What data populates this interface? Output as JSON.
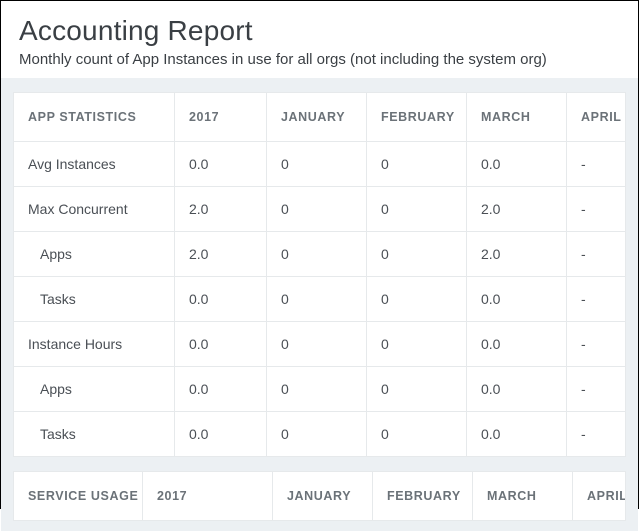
{
  "header": {
    "title": "Accounting Report",
    "subtitle": "Monthly count of App Instances in use for all orgs (not including the system org)"
  },
  "table1": {
    "columns": [
      "APP STATISTICS",
      "2017",
      "JANUARY",
      "FEBRUARY",
      "MARCH",
      "APRIL"
    ],
    "rows": [
      {
        "label": "Avg Instances",
        "indent": false,
        "values": [
          "0.0",
          "0",
          "0",
          "0.0",
          "-"
        ]
      },
      {
        "label": "Max Concurrent",
        "indent": false,
        "values": [
          "2.0",
          "0",
          "0",
          "2.0",
          "-"
        ]
      },
      {
        "label": "Apps",
        "indent": true,
        "values": [
          "2.0",
          "0",
          "0",
          "2.0",
          "-"
        ]
      },
      {
        "label": "Tasks",
        "indent": true,
        "values": [
          "0.0",
          "0",
          "0",
          "0.0",
          "-"
        ]
      },
      {
        "label": "Instance Hours",
        "indent": false,
        "values": [
          "0.0",
          "0",
          "0",
          "0.0",
          "-"
        ]
      },
      {
        "label": "Apps",
        "indent": true,
        "values": [
          "0.0",
          "0",
          "0",
          "0.0",
          "-"
        ]
      },
      {
        "label": "Tasks",
        "indent": true,
        "values": [
          "0.0",
          "0",
          "0",
          "0.0",
          "-"
        ]
      }
    ]
  },
  "table2": {
    "columns": [
      "SERVICE USAGE",
      "2017",
      "JANUARY",
      "FEBRUARY",
      "MARCH",
      "APRIL"
    ]
  }
}
